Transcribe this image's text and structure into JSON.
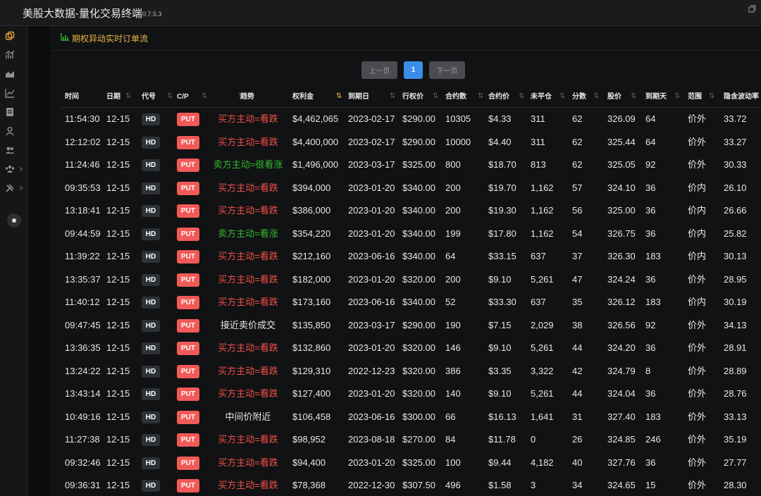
{
  "titlebar": {
    "title": "美股大数据-量化交易终端",
    "version": "0.7.5.3"
  },
  "panel": {
    "title": "期权异动实时订单流"
  },
  "pager": {
    "prev": "上一页",
    "current": "1",
    "next": "下一页"
  },
  "colors": {
    "accent": "#e9b64a",
    "sell": "#f2504b",
    "buy": "#34b833",
    "neutral": "#e8e8e8",
    "put_badge": "#f25a57",
    "page_active": "#3a8ee6"
  },
  "table": {
    "columns": [
      "时间",
      "日期",
      "代号",
      "C/P",
      "趋势",
      "权利金",
      "到期日",
      "行权价",
      "合约数",
      "合约价",
      "未平仓",
      "分数",
      "股价",
      "到期天",
      "范围",
      "隐含波动率"
    ],
    "rows": [
      {
        "time": "11:54:30",
        "date": "12-15",
        "sym": "HD",
        "cp": "PUT",
        "trend": "买方主动=看跌",
        "trend_type": "sell",
        "premium": "$4,462,065",
        "expiry": "2023-02-17",
        "strike": "$290.00",
        "contracts": "10305",
        "price": "$4.33",
        "oi": "311",
        "score": "62",
        "stock": "326.09",
        "days": "64",
        "range": "价外",
        "iv": "33.72"
      },
      {
        "time": "12:12:02",
        "date": "12-15",
        "sym": "HD",
        "cp": "PUT",
        "trend": "买方主动=看跌",
        "trend_type": "sell",
        "premium": "$4,400,000",
        "expiry": "2023-02-17",
        "strike": "$290.00",
        "contracts": "10000",
        "price": "$4.40",
        "oi": "311",
        "score": "62",
        "stock": "325.44",
        "days": "64",
        "range": "价外",
        "iv": "33.27"
      },
      {
        "time": "11:24:46",
        "date": "12-15",
        "sym": "HD",
        "cp": "PUT",
        "trend": "卖方主动=很看涨",
        "trend_type": "buy",
        "premium": "$1,496,000",
        "expiry": "2023-03-17",
        "strike": "$325.00",
        "contracts": "800",
        "price": "$18.70",
        "oi": "813",
        "score": "62",
        "stock": "325.05",
        "days": "92",
        "range": "价外",
        "iv": "30.33"
      },
      {
        "time": "09:35:53",
        "date": "12-15",
        "sym": "HD",
        "cp": "PUT",
        "trend": "买方主动=看跌",
        "trend_type": "sell",
        "premium": "$394,000",
        "expiry": "2023-01-20",
        "strike": "$340.00",
        "contracts": "200",
        "price": "$19.70",
        "oi": "1,162",
        "score": "57",
        "stock": "324.10",
        "days": "36",
        "range": "价内",
        "iv": "26.10"
      },
      {
        "time": "13:18:41",
        "date": "12-15",
        "sym": "HD",
        "cp": "PUT",
        "trend": "买方主动=看跌",
        "trend_type": "sell",
        "premium": "$386,000",
        "expiry": "2023-01-20",
        "strike": "$340.00",
        "contracts": "200",
        "price": "$19.30",
        "oi": "1,162",
        "score": "56",
        "stock": "325.00",
        "days": "36",
        "range": "价内",
        "iv": "26.66"
      },
      {
        "time": "09:44:59",
        "date": "12-15",
        "sym": "HD",
        "cp": "PUT",
        "trend": "卖方主动=看涨",
        "trend_type": "buy",
        "premium": "$354,220",
        "expiry": "2023-01-20",
        "strike": "$340.00",
        "contracts": "199",
        "price": "$17.80",
        "oi": "1,162",
        "score": "54",
        "stock": "326.75",
        "days": "36",
        "range": "价内",
        "iv": "25.82"
      },
      {
        "time": "11:39:22",
        "date": "12-15",
        "sym": "HD",
        "cp": "PUT",
        "trend": "买方主动=看跌",
        "trend_type": "sell",
        "premium": "$212,160",
        "expiry": "2023-06-16",
        "strike": "$340.00",
        "contracts": "64",
        "price": "$33.15",
        "oi": "637",
        "score": "37",
        "stock": "326.30",
        "days": "183",
        "range": "价内",
        "iv": "30.13"
      },
      {
        "time": "13:35:37",
        "date": "12-15",
        "sym": "HD",
        "cp": "PUT",
        "trend": "买方主动=看跌",
        "trend_type": "sell",
        "premium": "$182,000",
        "expiry": "2023-01-20",
        "strike": "$320.00",
        "contracts": "200",
        "price": "$9.10",
        "oi": "5,261",
        "score": "47",
        "stock": "324.24",
        "days": "36",
        "range": "价外",
        "iv": "28.95"
      },
      {
        "time": "11:40:12",
        "date": "12-15",
        "sym": "HD",
        "cp": "PUT",
        "trend": "买方主动=看跌",
        "trend_type": "sell",
        "premium": "$173,160",
        "expiry": "2023-06-16",
        "strike": "$340.00",
        "contracts": "52",
        "price": "$33.30",
        "oi": "637",
        "score": "35",
        "stock": "326.12",
        "days": "183",
        "range": "价内",
        "iv": "30.19"
      },
      {
        "time": "09:47:45",
        "date": "12-15",
        "sym": "HD",
        "cp": "PUT",
        "trend": "接近卖价成交",
        "trend_type": "neutral",
        "premium": "$135,850",
        "expiry": "2023-03-17",
        "strike": "$290.00",
        "contracts": "190",
        "price": "$7.15",
        "oi": "2,029",
        "score": "38",
        "stock": "326.56",
        "days": "92",
        "range": "价外",
        "iv": "34.13"
      },
      {
        "time": "13:36:35",
        "date": "12-15",
        "sym": "HD",
        "cp": "PUT",
        "trend": "买方主动=看跌",
        "trend_type": "sell",
        "premium": "$132,860",
        "expiry": "2023-01-20",
        "strike": "$320.00",
        "contracts": "146",
        "price": "$9.10",
        "oi": "5,261",
        "score": "44",
        "stock": "324.20",
        "days": "36",
        "range": "价外",
        "iv": "28.91"
      },
      {
        "time": "13:24:22",
        "date": "12-15",
        "sym": "HD",
        "cp": "PUT",
        "trend": "买方主动=看跌",
        "trend_type": "sell",
        "premium": "$129,310",
        "expiry": "2022-12-23",
        "strike": "$320.00",
        "contracts": "386",
        "price": "$3.35",
        "oi": "3,322",
        "score": "42",
        "stock": "324.79",
        "days": "8",
        "range": "价外",
        "iv": "28.89"
      },
      {
        "time": "13:43:14",
        "date": "12-15",
        "sym": "HD",
        "cp": "PUT",
        "trend": "买方主动=看跌",
        "trend_type": "sell",
        "premium": "$127,400",
        "expiry": "2023-01-20",
        "strike": "$320.00",
        "contracts": "140",
        "price": "$9.10",
        "oi": "5,261",
        "score": "44",
        "stock": "324.04",
        "days": "36",
        "range": "价外",
        "iv": "28.76"
      },
      {
        "time": "10:49:16",
        "date": "12-15",
        "sym": "HD",
        "cp": "PUT",
        "trend": "中间价附近",
        "trend_type": "neutral",
        "premium": "$106,458",
        "expiry": "2023-06-16",
        "strike": "$300.00",
        "contracts": "66",
        "price": "$16.13",
        "oi": "1,641",
        "score": "31",
        "stock": "327.40",
        "days": "183",
        "range": "价外",
        "iv": "33.13"
      },
      {
        "time": "11:27:38",
        "date": "12-15",
        "sym": "HD",
        "cp": "PUT",
        "trend": "买方主动=看跌",
        "trend_type": "sell",
        "premium": "$98,952",
        "expiry": "2023-08-18",
        "strike": "$270.00",
        "contracts": "84",
        "price": "$11.78",
        "oi": "0",
        "score": "26",
        "stock": "324.85",
        "days": "246",
        "range": "价外",
        "iv": "35.19"
      },
      {
        "time": "09:32:46",
        "date": "12-15",
        "sym": "HD",
        "cp": "PUT",
        "trend": "买方主动=看跌",
        "trend_type": "sell",
        "premium": "$94,400",
        "expiry": "2023-01-20",
        "strike": "$325.00",
        "contracts": "100",
        "price": "$9.44",
        "oi": "4,182",
        "score": "40",
        "stock": "327.76",
        "days": "36",
        "range": "价外",
        "iv": "27.77"
      },
      {
        "time": "09:36:31",
        "date": "12-15",
        "sym": "HD",
        "cp": "PUT",
        "trend": "买方主动=看跌",
        "trend_type": "sell",
        "premium": "$78,368",
        "expiry": "2022-12-30",
        "strike": "$307.50",
        "contracts": "496",
        "price": "$1.58",
        "oi": "3",
        "score": "34",
        "stock": "324.65",
        "days": "15",
        "range": "价外",
        "iv": "28.30"
      }
    ]
  }
}
